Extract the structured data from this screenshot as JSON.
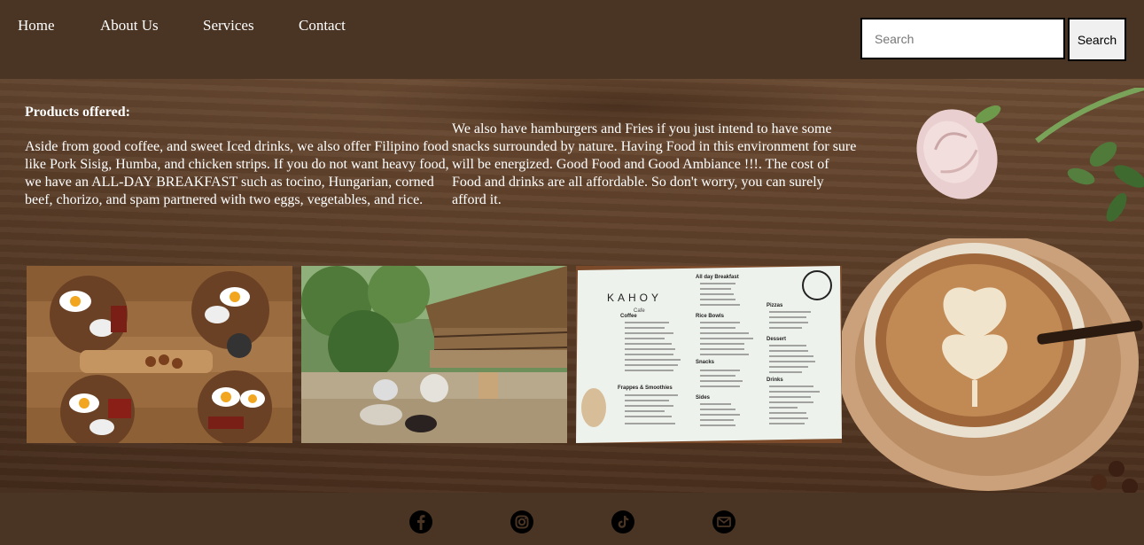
{
  "nav": {
    "links": [
      {
        "label": "Home"
      },
      {
        "label": "About Us"
      },
      {
        "label": "Services"
      },
      {
        "label": "Contact"
      }
    ],
    "search": {
      "placeholder": "Search",
      "value": "",
      "button_label": "Search"
    }
  },
  "content": {
    "heading": "Products offered:",
    "paragraph1": "Aside from good coffee, and sweet Iced drinks, we also offer Filipino food like Pork Sisig, Humba, and chicken strips. If you do not want heavy food, we have an ALL-DAY BREAKFAST such as tocino, Hungarian, corned beef, chorizo, and spam partnered with two eggs, vegetables, and rice.",
    "paragraph2": "We also have hamburgers and Fries if you just intend to have some snacks surrounded by nature. Having Food in this environment for sure will be energized. Good Food and Good Ambiance !!!. The cost of Food and drinks are all affordable. So don't worry, you can surely afford it."
  },
  "menu_card": {
    "brand": "KAHOY",
    "brand_sub": "Cafe",
    "section_breakfast": "All day Breakfast",
    "section_coffee": "Coffee",
    "section_rice": "Rice Bowls",
    "section_pizzas": "Pizzas",
    "section_dessert": "Dessert",
    "section_frappes": "Frappes & Smoothies",
    "section_snacks": "Snacks",
    "section_sides": "Sides",
    "section_drinks": "Drinks"
  },
  "footer": {
    "social": [
      "facebook-icon",
      "instagram-icon",
      "tiktok-icon",
      "mail-icon"
    ]
  },
  "colors": {
    "header_bg": "#4a3423",
    "text": "#ffffff",
    "search_border": "#000000"
  }
}
